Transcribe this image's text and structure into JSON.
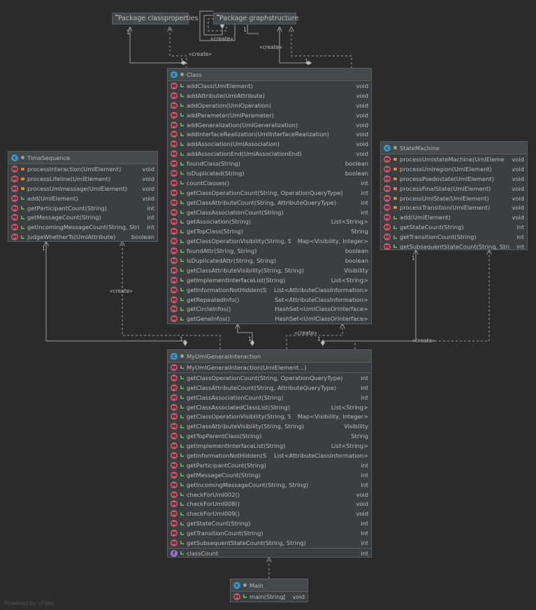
{
  "packages": {
    "classproperties": "Package classproperties",
    "graphstructure": "Package graphstructure"
  },
  "labels": {
    "create": "«create»",
    "one": "1"
  },
  "classes": {
    "class": {
      "name": "Class",
      "methods": [
        {
          "sig": "addClass(UmlElement)",
          "ret": "void"
        },
        {
          "sig": "addAttribute(UmlAttribute)",
          "ret": "void"
        },
        {
          "sig": "addOperation(UmlOperation)",
          "ret": "void"
        },
        {
          "sig": "addParameter(UmlParameter)",
          "ret": "void"
        },
        {
          "sig": "addGeneralization(UmlGeneralization)",
          "ret": "void"
        },
        {
          "sig": "addInterfaceRealization(UmlInterfaceRealization)",
          "ret": "void"
        },
        {
          "sig": "addAssociation(UmlAssociation)",
          "ret": "void"
        },
        {
          "sig": "addAssociationEnd(UmlAssociationEnd)",
          "ret": "void"
        },
        {
          "sig": "foundClass(String)",
          "ret": "boolean"
        },
        {
          "sig": "isDuplicated(String)",
          "ret": "boolean"
        },
        {
          "sig": "countClasses()",
          "ret": "int"
        },
        {
          "sig": "getClassOperationCount(String, OperationQueryType)",
          "ret": "int"
        },
        {
          "sig": "getClassAttributeCount(String, AttributeQueryType)",
          "ret": "int"
        },
        {
          "sig": "getClassAssociationCount(String)",
          "ret": "int"
        },
        {
          "sig": "getAssociation(String)",
          "ret": "List<String>"
        },
        {
          "sig": "getTopClass(String)",
          "ret": "String"
        },
        {
          "sig": "getClassOperationVisibility(String, String)",
          "ret": "Map<Visibility, Integer>"
        },
        {
          "sig": "foundAttr(String, String)",
          "ret": "boolean"
        },
        {
          "sig": "isDuplicatedAttr(String, String)",
          "ret": "boolean"
        },
        {
          "sig": "getClassAttributeVisibility(String, String)",
          "ret": "Visibility"
        },
        {
          "sig": "getImplementInterfaceList(String)",
          "ret": "List<String>"
        },
        {
          "sig": "getInformationNotHidden(String)",
          "ret": "List<AttributeClassInformation>"
        },
        {
          "sig": "getRepeatedInfo()",
          "ret": "Set<AttributeClassInformation>"
        },
        {
          "sig": "getCircleInfos()",
          "ret": "HashSet<UmlClassOrInterface>"
        },
        {
          "sig": "getGeneInfos()",
          "ret": "HashSet<UmlClassOrInterface>"
        }
      ]
    },
    "timesequence": {
      "name": "TimeSequence",
      "methods": [
        {
          "sig": "processInteraction(UmlElement)",
          "ret": "void",
          "vis": "private"
        },
        {
          "sig": "processLifeline(UmlElement)",
          "ret": "void",
          "vis": "private"
        },
        {
          "sig": "processUmlmessage(UmlElement)",
          "ret": "void",
          "vis": "private"
        },
        {
          "sig": "add(UmlElement)",
          "ret": "void"
        },
        {
          "sig": "getParticipantCount(String)",
          "ret": "int"
        },
        {
          "sig": "getMessageCount(String)",
          "ret": "int"
        },
        {
          "sig": "getIncomingMessageCount(String, String)",
          "ret": "int"
        },
        {
          "sig": "judgeWhetherTs(UmlAttribute)",
          "ret": "boolean"
        }
      ]
    },
    "statemachine": {
      "name": "StateMachine",
      "methods": [
        {
          "sig": "processUmlstateMachine(UmlElement)",
          "ret": "void",
          "vis": "private"
        },
        {
          "sig": "processUmlregion(UmlElement)",
          "ret": "void",
          "vis": "private"
        },
        {
          "sig": "processPsedostate(UmlElement)",
          "ret": "void",
          "vis": "private"
        },
        {
          "sig": "processFinalState(UmlElement)",
          "ret": "void",
          "vis": "private"
        },
        {
          "sig": "processUmlState(UmlElement)",
          "ret": "void",
          "vis": "private"
        },
        {
          "sig": "processTransition(UmlElement)",
          "ret": "void",
          "vis": "private"
        },
        {
          "sig": "add(UmlElement)",
          "ret": "void"
        },
        {
          "sig": "getStateCount(String)",
          "ret": "int"
        },
        {
          "sig": "getTransitionCount(String)",
          "ret": "int"
        },
        {
          "sig": "getSubsequentStateCount(String, String)",
          "ret": "int"
        }
      ]
    },
    "myuml": {
      "name": "MyUmlGeneralInteraction",
      "constructor": "MyUmlGeneralInteraction(UmlElement...)",
      "methods": [
        {
          "sig": "getClassOperationCount(String, OperationQueryType)",
          "ret": "int"
        },
        {
          "sig": "getClassAttributeCount(String, AttributeQueryType)",
          "ret": "int"
        },
        {
          "sig": "getClassAssociationCount(String)",
          "ret": "int"
        },
        {
          "sig": "getClassAssociatedClassList(String)",
          "ret": "List<String>"
        },
        {
          "sig": "getClassOperationVisibility(String, String)",
          "ret": "Map<Visibility, Integer>"
        },
        {
          "sig": "getClassAttributeVisibility(String, String)",
          "ret": "Visibility"
        },
        {
          "sig": "getTopParentClass(String)",
          "ret": "String"
        },
        {
          "sig": "getImplementInterfaceList(String)",
          "ret": "List<String>"
        },
        {
          "sig": "getInformationNotHidden(String)",
          "ret": "List<AttributeClassInformation>"
        },
        {
          "sig": "getParticipantCount(String)",
          "ret": "int"
        },
        {
          "sig": "getMessageCount(String)",
          "ret": "int"
        },
        {
          "sig": "getIncomingMessageCount(String, String)",
          "ret": "int"
        },
        {
          "sig": "checkForUml002()",
          "ret": "void"
        },
        {
          "sig": "checkForUml008()",
          "ret": "void"
        },
        {
          "sig": "checkForUml009()",
          "ret": "void"
        },
        {
          "sig": "getStateCount(String)",
          "ret": "int"
        },
        {
          "sig": "getTransitionCount(String)",
          "ret": "int"
        },
        {
          "sig": "getSubsequentStateCount(String, String)",
          "ret": "int"
        }
      ],
      "fields": [
        {
          "sig": "classCount",
          "ret": "int"
        }
      ]
    },
    "main": {
      "name": "Main",
      "methods": [
        {
          "sig": "main(String[])",
          "ret": "void"
        }
      ]
    }
  },
  "watermark": "Powered by yFiles"
}
